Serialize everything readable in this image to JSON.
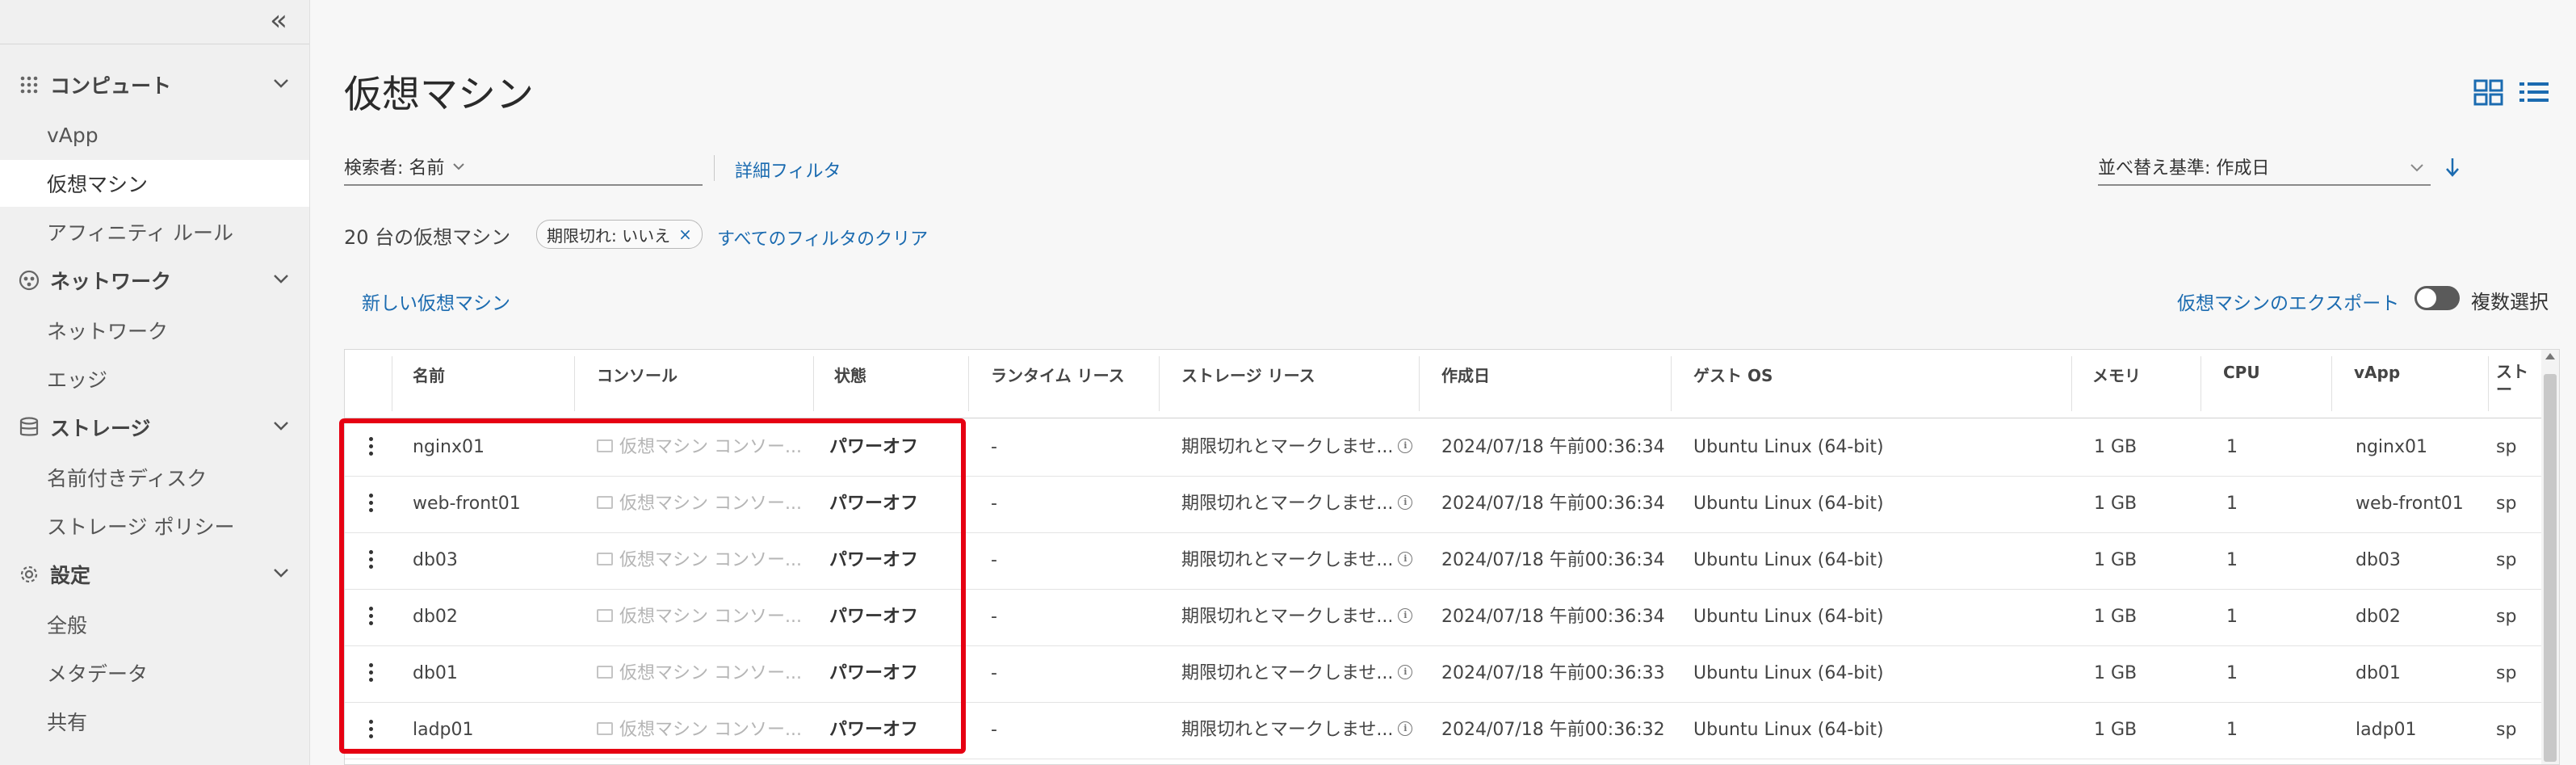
{
  "sidebar": {
    "collapse_glyph": "«",
    "sections": [
      {
        "label": "コンピュート",
        "icon": "grid-icon",
        "items": [
          {
            "label": "vApp"
          },
          {
            "label": "仮想マシン",
            "active": true
          },
          {
            "label": "アフィニティ ルール"
          }
        ]
      },
      {
        "label": "ネットワーク",
        "icon": "network-icon",
        "items": [
          {
            "label": "ネットワーク"
          },
          {
            "label": "エッジ"
          }
        ]
      },
      {
        "label": "ストレージ",
        "icon": "storage-icon",
        "items": [
          {
            "label": "名前付きディスク"
          },
          {
            "label": "ストレージ ポリシー"
          }
        ]
      },
      {
        "label": "設定",
        "icon": "gear-icon",
        "items": [
          {
            "label": "全般"
          },
          {
            "label": "メタデータ"
          },
          {
            "label": "共有"
          }
        ]
      }
    ]
  },
  "page": {
    "title": "仮想マシン",
    "search_label": "検索者: 名前",
    "advanced_filter": "詳細フィルタ",
    "sort_label": "並べ替え基準: 作成日",
    "count_text": "20 台の仮想マシン",
    "chip_label": "期限切れ: いいえ",
    "chip_close": "×",
    "clear_filters": "すべてのフィルタのクリア",
    "new_vm": "新しい仮想マシン",
    "export_vm": "仮想マシンのエクスポート",
    "multi_select": "複数選択"
  },
  "table": {
    "headers": [
      "名前",
      "コンソール",
      "状態",
      "ランタイム リース",
      "ストレージ リース",
      "作成日",
      "ゲスト OS",
      "メモリ",
      "CPU",
      "vApp",
      "スト\nー"
    ],
    "rows": [
      {
        "name": "nginx01",
        "console": "仮想マシン コンソー...",
        "state": "パワーオフ",
        "runtime": "-",
        "storage": "期限切れとマークしませ...",
        "created": "2024/07/18 午前00:36:34",
        "os": "Ubuntu Linux (64-bit)",
        "memory": "1 GB",
        "cpu": "1",
        "vapp": "nginx01",
        "extra": "sp"
      },
      {
        "name": "web-front01",
        "console": "仮想マシン コンソー...",
        "state": "パワーオフ",
        "runtime": "-",
        "storage": "期限切れとマークしませ...",
        "created": "2024/07/18 午前00:36:34",
        "os": "Ubuntu Linux (64-bit)",
        "memory": "1 GB",
        "cpu": "1",
        "vapp": "web-front01",
        "extra": "sp"
      },
      {
        "name": "db03",
        "console": "仮想マシン コンソー...",
        "state": "パワーオフ",
        "runtime": "-",
        "storage": "期限切れとマークしませ...",
        "created": "2024/07/18 午前00:36:34",
        "os": "Ubuntu Linux (64-bit)",
        "memory": "1 GB",
        "cpu": "1",
        "vapp": "db03",
        "extra": "sp"
      },
      {
        "name": "db02",
        "console": "仮想マシン コンソー...",
        "state": "パワーオフ",
        "runtime": "-",
        "storage": "期限切れとマークしませ...",
        "created": "2024/07/18 午前00:36:34",
        "os": "Ubuntu Linux (64-bit)",
        "memory": "1 GB",
        "cpu": "1",
        "vapp": "db02",
        "extra": "sp"
      },
      {
        "name": "db01",
        "console": "仮想マシン コンソー...",
        "state": "パワーオフ",
        "runtime": "-",
        "storage": "期限切れとマークしませ...",
        "created": "2024/07/18 午前00:36:33",
        "os": "Ubuntu Linux (64-bit)",
        "memory": "1 GB",
        "cpu": "1",
        "vapp": "db01",
        "extra": "sp"
      },
      {
        "name": "ladp01",
        "console": "仮想マシン コンソー...",
        "state": "パワーオフ",
        "runtime": "-",
        "storage": "期限切れとマークしませ...",
        "created": "2024/07/18 午前00:36:32",
        "os": "Ubuntu Linux (64-bit)",
        "memory": "1 GB",
        "cpu": "1",
        "vapp": "ladp01",
        "extra": "sp"
      }
    ]
  },
  "colors": {
    "link": "#1b6bb0",
    "highlight": "#e60012"
  }
}
